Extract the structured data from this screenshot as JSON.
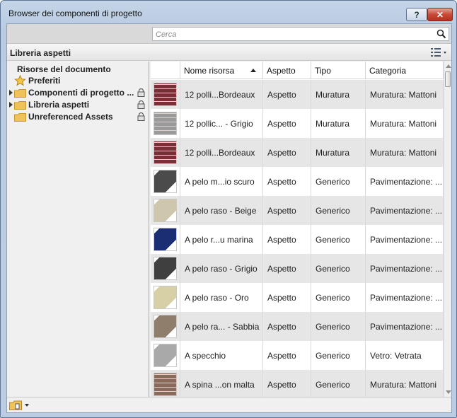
{
  "window": {
    "title": "Browser dei componenti di progetto",
    "help_label": "?",
    "close_label": "✕"
  },
  "search": {
    "placeholder": "Cerca",
    "value": ""
  },
  "library": {
    "label": "Libreria aspetti"
  },
  "tree": {
    "root": "Risorse del documento",
    "items": [
      {
        "label": "Preferiti",
        "icon": "star-icon",
        "expandable": false,
        "locked": false
      },
      {
        "label": "Componenti di progetto ...",
        "icon": "folder-icon",
        "expandable": true,
        "locked": true
      },
      {
        "label": "Libreria aspetti",
        "icon": "folder-icon",
        "expandable": true,
        "locked": true
      },
      {
        "label": "Unreferenced Assets",
        "icon": "folder-icon",
        "expandable": false,
        "locked": true
      }
    ]
  },
  "grid": {
    "columns": [
      "Nome risorsa",
      "Aspetto",
      "Tipo",
      "Categoria"
    ],
    "sorted_column": "Nome risorsa",
    "rows": [
      {
        "name": "12 polli...Bordeaux",
        "aspect": "Aspetto",
        "type": "Muratura",
        "category": "Muratura: Mattoni",
        "thumb": "brick-bordeaux"
      },
      {
        "name": "12 pollic... - Grigio",
        "aspect": "Aspetto",
        "type": "Muratura",
        "category": "Muratura: Mattoni",
        "thumb": "brick-grey"
      },
      {
        "name": "12 polli...Bordeaux",
        "aspect": "Aspetto",
        "type": "Muratura",
        "category": "Muratura: Mattoni",
        "thumb": "brick-bordeaux"
      },
      {
        "name": "A pelo m...io scuro",
        "aspect": "Aspetto",
        "type": "Generico",
        "category": "Pavimentazione: ...",
        "thumb": "cube-darkgrey"
      },
      {
        "name": "A pelo raso - Beige",
        "aspect": "Aspetto",
        "type": "Generico",
        "category": "Pavimentazione: ...",
        "thumb": "cube-beige"
      },
      {
        "name": "A pelo r...u marina",
        "aspect": "Aspetto",
        "type": "Generico",
        "category": "Pavimentazione: ...",
        "thumb": "cube-navy"
      },
      {
        "name": "A pelo raso - Grigio",
        "aspect": "Aspetto",
        "type": "Generico",
        "category": "Pavimentazione: ...",
        "thumb": "cube-grey"
      },
      {
        "name": "A pelo raso - Oro",
        "aspect": "Aspetto",
        "type": "Generico",
        "category": "Pavimentazione: ...",
        "thumb": "cube-gold"
      },
      {
        "name": "A pelo ra... - Sabbia",
        "aspect": "Aspetto",
        "type": "Generico",
        "category": "Pavimentazione: ...",
        "thumb": "cube-sand"
      },
      {
        "name": "A specchio",
        "aspect": "Aspetto",
        "type": "Generico",
        "category": "Vetro: Vetrata",
        "thumb": "cube-mirror"
      },
      {
        "name": "A spina ...on malta",
        "aspect": "Aspetto",
        "type": "Generico",
        "category": "Muratura: Mattoni",
        "thumb": "brick-herringbone"
      }
    ]
  },
  "colors": {
    "brick-bordeaux": "#7a2f36",
    "brick-grey": "#9a9a9a",
    "cube-darkgrey": "#4b4b4b",
    "cube-beige": "#cfc7ad",
    "cube-navy": "#1b2e73",
    "cube-grey": "#3f3f3f",
    "cube-gold": "#d7cfa6",
    "cube-sand": "#8f7e6c",
    "cube-mirror": "#a9a9a9",
    "brick-herringbone": "#8a6a5a"
  }
}
